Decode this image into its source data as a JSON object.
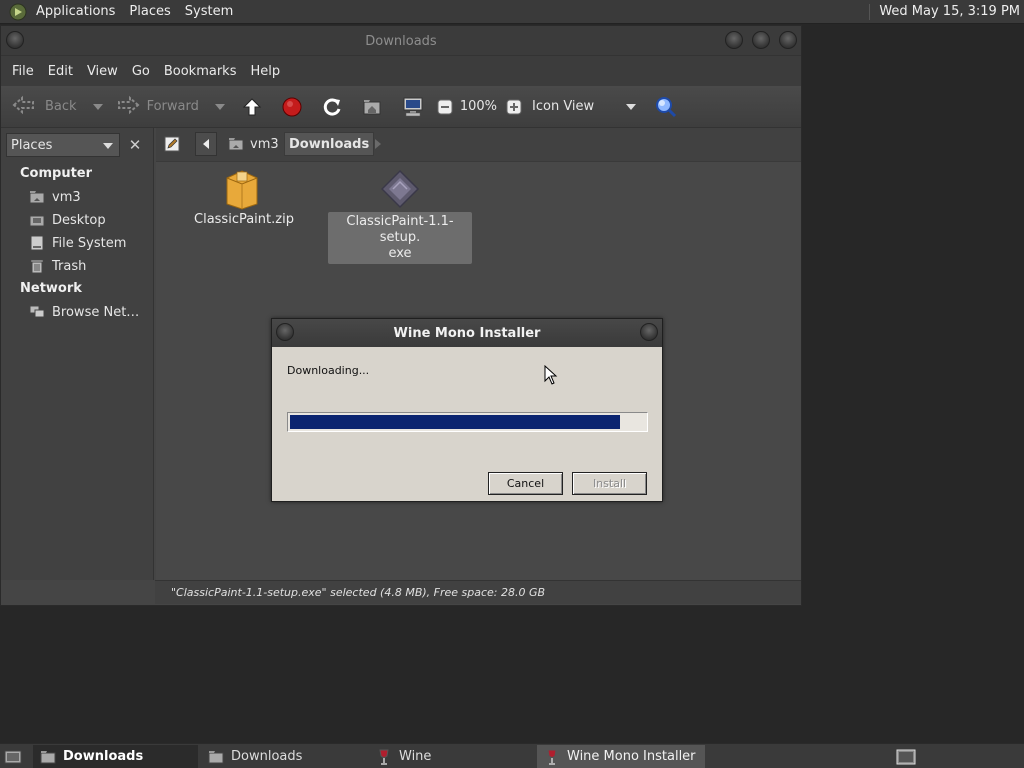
{
  "top_panel": {
    "menus": [
      "Applications",
      "Places",
      "System"
    ],
    "clock": "Wed May 15,  3:19 PM"
  },
  "file_manager": {
    "title": "Downloads",
    "menu": [
      "File",
      "Edit",
      "View",
      "Go",
      "Bookmarks",
      "Help"
    ],
    "toolbar": {
      "back_label": "Back",
      "forward_label": "Forward",
      "zoom": "100%",
      "view_mode": "Icon View"
    },
    "sidebar": {
      "selector": "Places",
      "sections": [
        {
          "heading": "Computer",
          "items": [
            "vm3",
            "Desktop",
            "File System",
            "Trash"
          ]
        },
        {
          "heading": "Network",
          "items": [
            "Browse Net…"
          ]
        }
      ]
    },
    "breadcrumb": [
      "vm3",
      "Downloads"
    ],
    "files": [
      {
        "name": "ClassicPaint.zip",
        "icon": "archive-icon"
      },
      {
        "name_line1": "ClassicPaint-1.1-setup.",
        "name_line2": "exe",
        "icon": "executable-icon"
      }
    ],
    "status": "\"ClassicPaint-1.1-setup.exe\" selected (4.8 MB), Free space: 28.0 GB"
  },
  "wine_dialog": {
    "title": "Wine Mono Installer",
    "status": "Downloading...",
    "progress": 0.93,
    "progress_color": "#0b2470",
    "cancel_label": "Cancel",
    "install_label": "Install"
  },
  "taskbar": {
    "tasks": [
      "Downloads",
      "Downloads",
      "Wine",
      "Wine Mono Installer"
    ]
  }
}
